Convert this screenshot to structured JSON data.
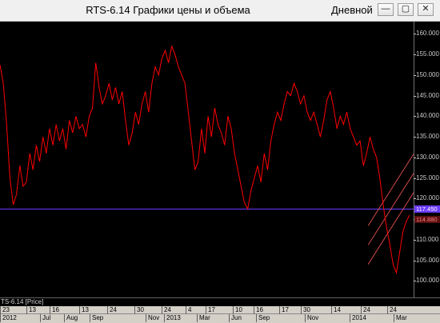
{
  "window": {
    "title": "RTS-6.14 Графики цены и объема",
    "period": "Дневной",
    "minimize_icon": "minimize-icon",
    "maximize_icon": "maximize-icon",
    "close_icon": "close-icon",
    "minimize_glyph": "—",
    "maximize_glyph": "▢",
    "close_glyph": "✕"
  },
  "series_label": "TS-6.14 [Price]",
  "price_tags": {
    "support": "117.450",
    "last": "114.880"
  },
  "colors": {
    "background": "#000000",
    "price_line": "#ff0000",
    "support_line": "#6a3cff",
    "channel": "#ff5a5a"
  },
  "x_axis": {
    "days": [
      "23",
      "13",
      "16",
      "13",
      "24",
      "30",
      "24",
      "4",
      "17",
      "10",
      "16",
      "17",
      "30",
      "14",
      "24",
      "24"
    ],
    "months": [
      "2012",
      "Jul",
      "Aug",
      "Sep",
      "Nov",
      "2013",
      "Mar",
      "Jun",
      "Sep",
      "Nov",
      "2014",
      "Mar"
    ]
  },
  "chart_data": {
    "type": "line",
    "ylim": [
      96000,
      163000
    ],
    "y_ticks": [
      "160.000",
      "155.000",
      "150.000",
      "145.000",
      "140.000",
      "135.000",
      "130.000",
      "125.000",
      "120.000",
      "115.000",
      "110.000",
      "105.000",
      "100.000"
    ],
    "support_level": 117450,
    "last_price": 114880,
    "series": [
      {
        "values": [
          152500,
          148000,
          138000,
          125000,
          118500,
          121000,
          128000,
          123000,
          124000,
          131000,
          127000,
          133000,
          129000,
          135000,
          131000,
          137000,
          133000,
          138000,
          134000,
          137000,
          132000,
          139000,
          136000,
          140000,
          137000,
          138000,
          135000,
          140000,
          142000,
          153000,
          147000,
          143000,
          145000,
          148000,
          144000,
          147000,
          143000,
          146000,
          139000,
          133000,
          136000,
          141000,
          138000,
          143000,
          146000,
          141000,
          148000,
          152000,
          150000,
          154000,
          156000,
          153000,
          157000,
          155000,
          152000,
          150000,
          148000,
          141000,
          134000,
          127000,
          129000,
          137000,
          131000,
          140000,
          135000,
          142000,
          138000,
          136000,
          133000,
          140000,
          137000,
          131000,
          127000,
          123000,
          119000,
          117500,
          122000,
          125000,
          128000,
          124000,
          131000,
          127000,
          134000,
          138000,
          141000,
          139000,
          143000,
          146000,
          145000,
          148000,
          146000,
          143000,
          145000,
          141000,
          139000,
          141000,
          138000,
          135000,
          139000,
          144000,
          146000,
          142000,
          137000,
          140000,
          138000,
          141000,
          137000,
          135000,
          133000,
          134000,
          128000,
          131000,
          135000,
          132000,
          130000,
          125000,
          118500,
          113000,
          109000,
          104000,
          102000,
          107000,
          112000,
          114500,
          116000
        ],
        "channel_lines": [
          {
            "from": [
              0.89,
              0.12
            ],
            "to": [
              1.0,
              0.38
            ]
          },
          {
            "from": [
              0.89,
              0.19
            ],
            "to": [
              1.0,
              0.45
            ]
          },
          {
            "from": [
              0.89,
              0.26
            ],
            "to": [
              1.0,
              0.52
            ]
          }
        ]
      }
    ]
  }
}
